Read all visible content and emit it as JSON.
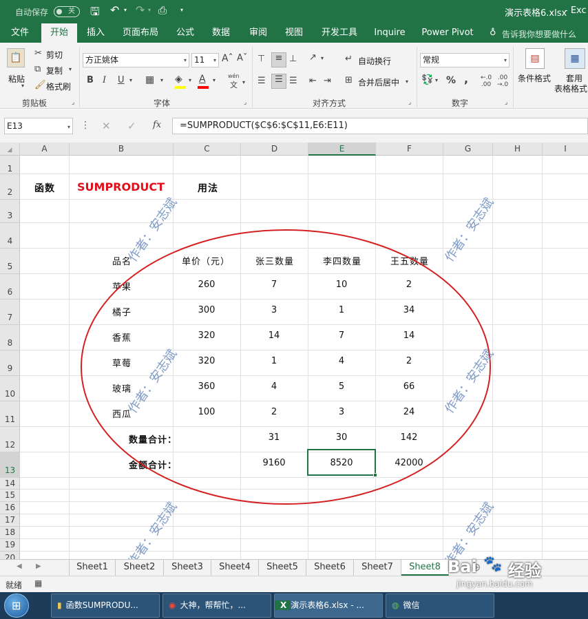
{
  "titlebar": {
    "autosave_label": "自动保存",
    "autosave_state": "关",
    "filename": "演示表格6.xlsx",
    "app_fragment": "Exc"
  },
  "ribbon_tabs": [
    "文件",
    "开始",
    "插入",
    "页面布局",
    "公式",
    "数据",
    "审阅",
    "视图",
    "开发工具",
    "Inquire",
    "Power Pivot"
  ],
  "tell_me": "告诉我你想要做什么",
  "clipboard": {
    "paste": "粘贴",
    "cut": "剪切",
    "copy": "复制",
    "format_painter": "格式刷",
    "group": "剪贴板"
  },
  "font": {
    "name": "方正姚体",
    "size": "11",
    "group": "字体",
    "bold": "B",
    "italic": "I",
    "underline": "U",
    "wen_label": "wén",
    "wen_char": "文"
  },
  "alignment": {
    "wrap": "自动换行",
    "merge": "合并后居中",
    "group": "对齐方式"
  },
  "number": {
    "format": "常规",
    "group": "数字",
    "percent": "%",
    "comma": ","
  },
  "styles": {
    "conditional": "条件格式",
    "table_line1": "套用",
    "table_line2": "表格格式"
  },
  "formula_bar": {
    "name_box": "E13",
    "fx": "fx",
    "formula": "=SUMPRODUCT($C$6:$C$11,E6:E11)"
  },
  "columns": [
    "A",
    "B",
    "C",
    "D",
    "E",
    "F",
    "G",
    "H",
    "I"
  ],
  "rows": [
    "1",
    "2",
    "3",
    "4",
    "5",
    "6",
    "7",
    "8",
    "9",
    "10",
    "11",
    "12",
    "13",
    "14",
    "15",
    "16",
    "17",
    "18",
    "19",
    "20"
  ],
  "sheet": {
    "row2": {
      "func_label": "函数",
      "func_name": "SUMPRODUCT",
      "usage_label": "用法"
    },
    "headers": [
      "品名",
      "单价（元）",
      "张三数量",
      "李四数量",
      "王五数量"
    ],
    "items": [
      {
        "name": "苹果",
        "price": "260",
        "zs": "7",
        "ls": "10",
        "ww": "2"
      },
      {
        "name": "橘子",
        "price": "300",
        "zs": "3",
        "ls": "1",
        "ww": "34"
      },
      {
        "name": "香蕉",
        "price": "320",
        "zs": "14",
        "ls": "7",
        "ww": "14"
      },
      {
        "name": "草莓",
        "price": "320",
        "zs": "1",
        "ls": "4",
        "ww": "2"
      },
      {
        "name": "玻璃",
        "price": "360",
        "zs": "4",
        "ls": "5",
        "ww": "66"
      },
      {
        "name": "西瓜",
        "price": "100",
        "zs": "2",
        "ls": "3",
        "ww": "24"
      }
    ],
    "qty_total_label": "数量合计：",
    "qty_totals": [
      "31",
      "30",
      "142"
    ],
    "amount_total_label": "金额合计：",
    "amount_totals": [
      "9160",
      "8520",
      "42000"
    ]
  },
  "watermark": "作者：安志斌",
  "sheet_tabs": [
    "Sheet1",
    "Sheet2",
    "Sheet3",
    "Sheet4",
    "Sheet5",
    "Sheet6",
    "Sheet7",
    "Sheet8"
  ],
  "active_sheet": "Sheet8",
  "status": {
    "ready": "就绪"
  },
  "baidu": {
    "logo": "Bai",
    "jingyan": "经验",
    "url": "jingyan.baidu.com"
  },
  "taskbar": {
    "items": [
      "函数SUMPRODU...",
      "大神，帮帮忙，...",
      "演示表格6.xlsx - ...",
      "微信"
    ]
  },
  "colors": {
    "excel_green": "#217346",
    "ellipse_red": "#d42020",
    "watermark_blue": "#6a8bbf",
    "func_red": "#e0101a"
  }
}
